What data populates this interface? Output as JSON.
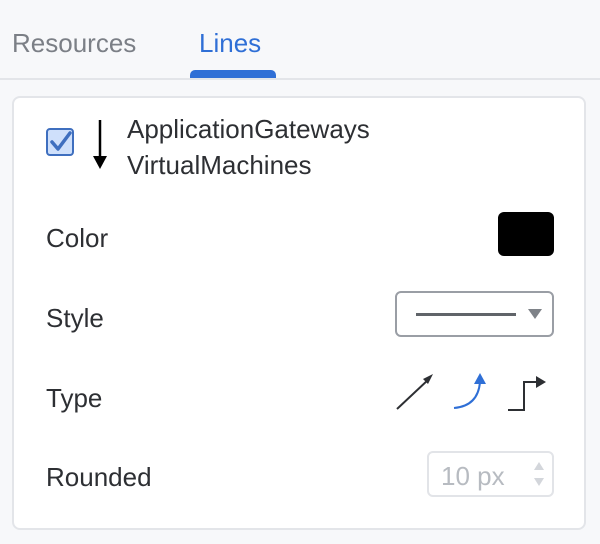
{
  "tabs": [
    {
      "label": "Resources",
      "active": false
    },
    {
      "label": "Lines",
      "active": true
    }
  ],
  "connection": {
    "selected": true,
    "source": "ApplicationGateways",
    "target": "VirtualMachines",
    "direction_icon": "arrow-down-icon"
  },
  "properties": {
    "color": {
      "label": "Color",
      "value": "#000000"
    },
    "style": {
      "label": "Style",
      "selected": "solid-line"
    },
    "type": {
      "label": "Type",
      "options": [
        "straight-arrow-icon",
        "curved-arrow-icon",
        "orthogonal-arrow-icon"
      ],
      "selected": "curved-arrow-icon"
    },
    "rounded": {
      "label": "Rounded",
      "value": "10 px"
    }
  },
  "colors": {
    "accent": "#2f6fd6",
    "checkbox_fill": "#cfe0fb",
    "text": "#2d2f33",
    "muted": "#7b7f86"
  }
}
